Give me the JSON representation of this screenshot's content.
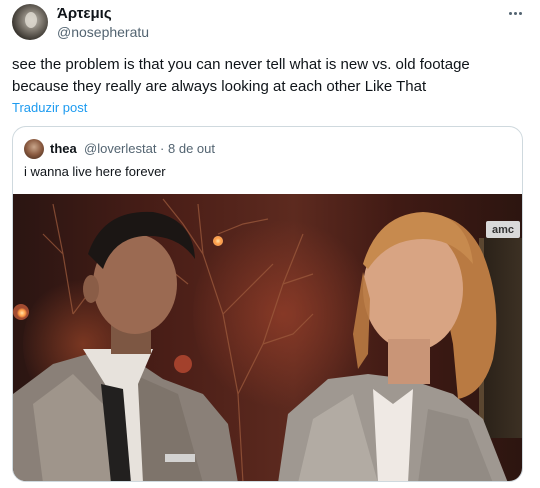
{
  "author": {
    "display_name": "Άρτεμις",
    "handle": "@nosepheratu"
  },
  "tweet": {
    "text": "see the problem is that you can never tell what is new vs. old footage because they really are always looking at each other Like That",
    "translate_label": "Traduzir post"
  },
  "quoted": {
    "display_name": "thea",
    "handle_date": "@loverlestat · 8 de out",
    "text": "i wanna live here forever",
    "media_watermark": "amc"
  },
  "icons": {
    "more": "more-horizontal-icon"
  },
  "colors": {
    "text": "#0f1419",
    "secondary": "#536471",
    "link": "#1d9bf0",
    "border": "#cfd9de"
  }
}
